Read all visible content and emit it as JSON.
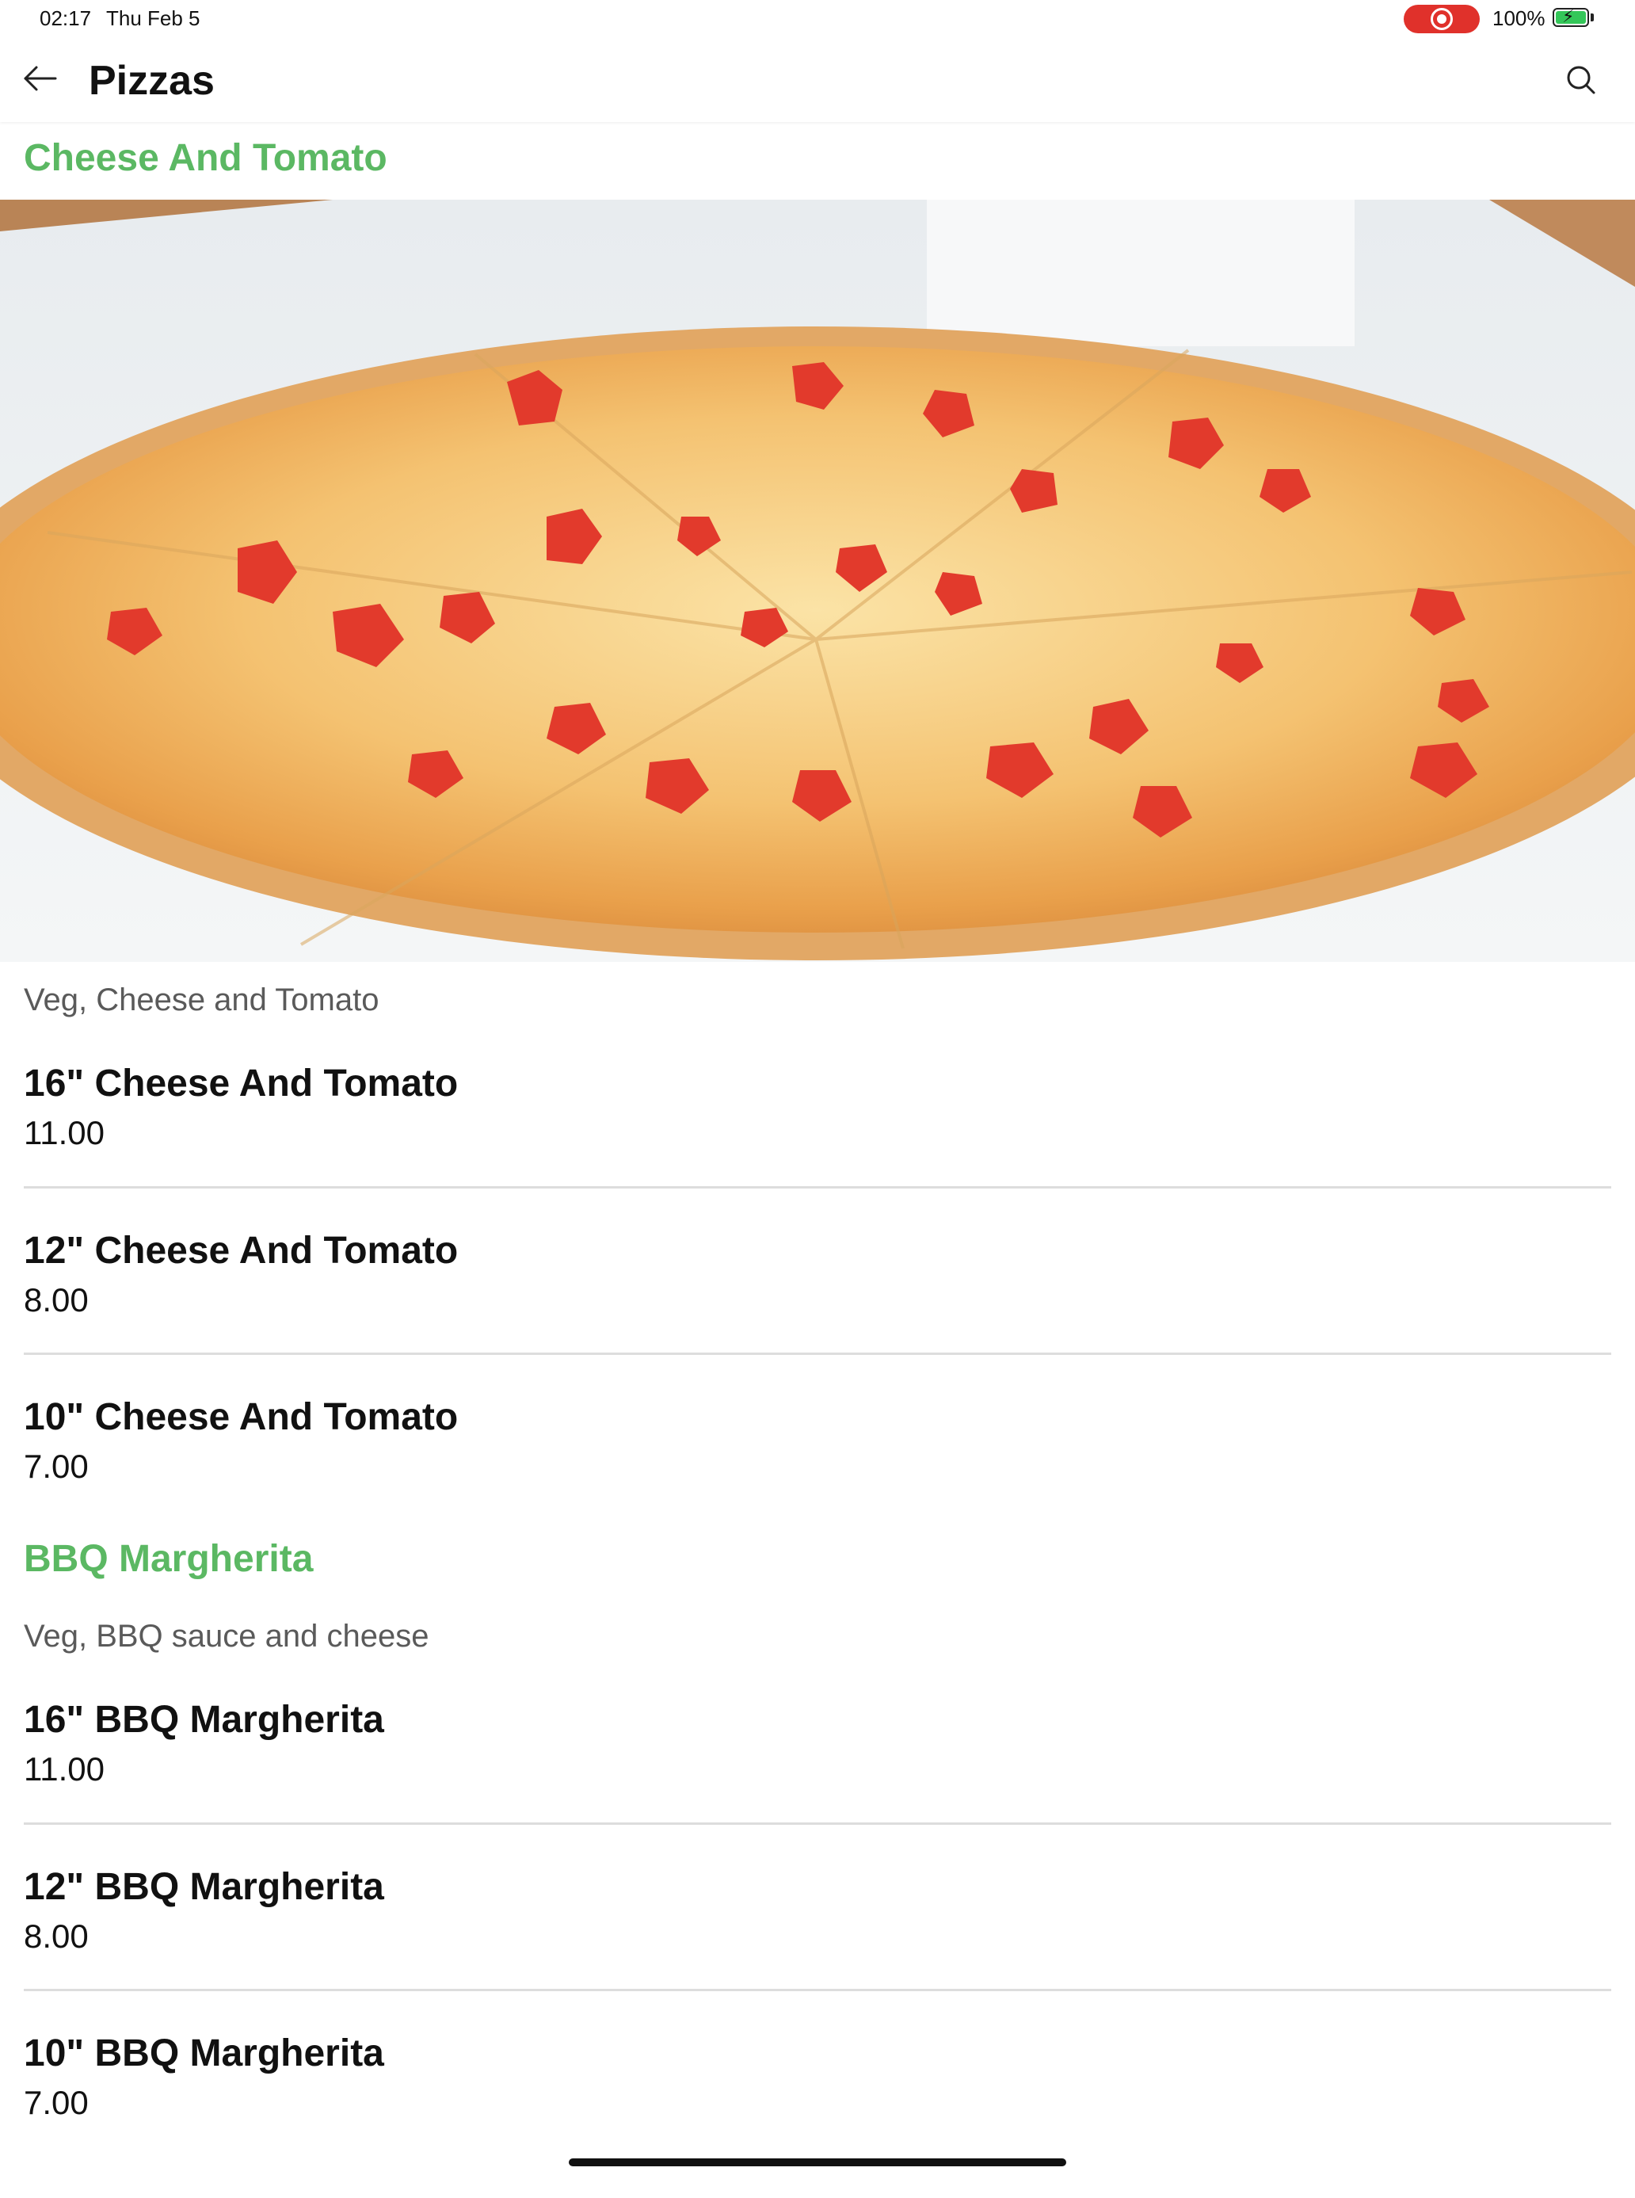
{
  "status_bar": {
    "time": "02:17",
    "date": "Thu Feb 5",
    "battery_percent": "100%",
    "battery_level": 1.0,
    "battery_charging": true,
    "screen_recording": true,
    "record_color": "#e0312b",
    "battery_fill_color": "#34c759"
  },
  "header": {
    "title": "Pizzas",
    "back_icon": "arrow-left-icon",
    "search_icon": "search-icon"
  },
  "colors": {
    "accent": "#5bb863",
    "description": "#5a5a5a",
    "divider": "#dddddd"
  },
  "sections": [
    {
      "title": "Cheese And Tomato",
      "description": "Veg, Cheese and Tomato",
      "items": [
        {
          "name": "16\" Cheese And Tomato",
          "price": "11.00"
        },
        {
          "name": "12\" Cheese And Tomato",
          "price": "8.00"
        },
        {
          "name": "10\" Cheese And Tomato",
          "price": "7.00"
        }
      ]
    },
    {
      "title": "BBQ Margherita",
      "description": "Veg, BBQ sauce and cheese",
      "items": [
        {
          "name": "16\" BBQ Margherita",
          "price": "11.00"
        },
        {
          "name": "12\" BBQ Margherita",
          "price": "8.00"
        },
        {
          "name": "10\" BBQ Margherita",
          "price": "7.00"
        }
      ]
    }
  ]
}
